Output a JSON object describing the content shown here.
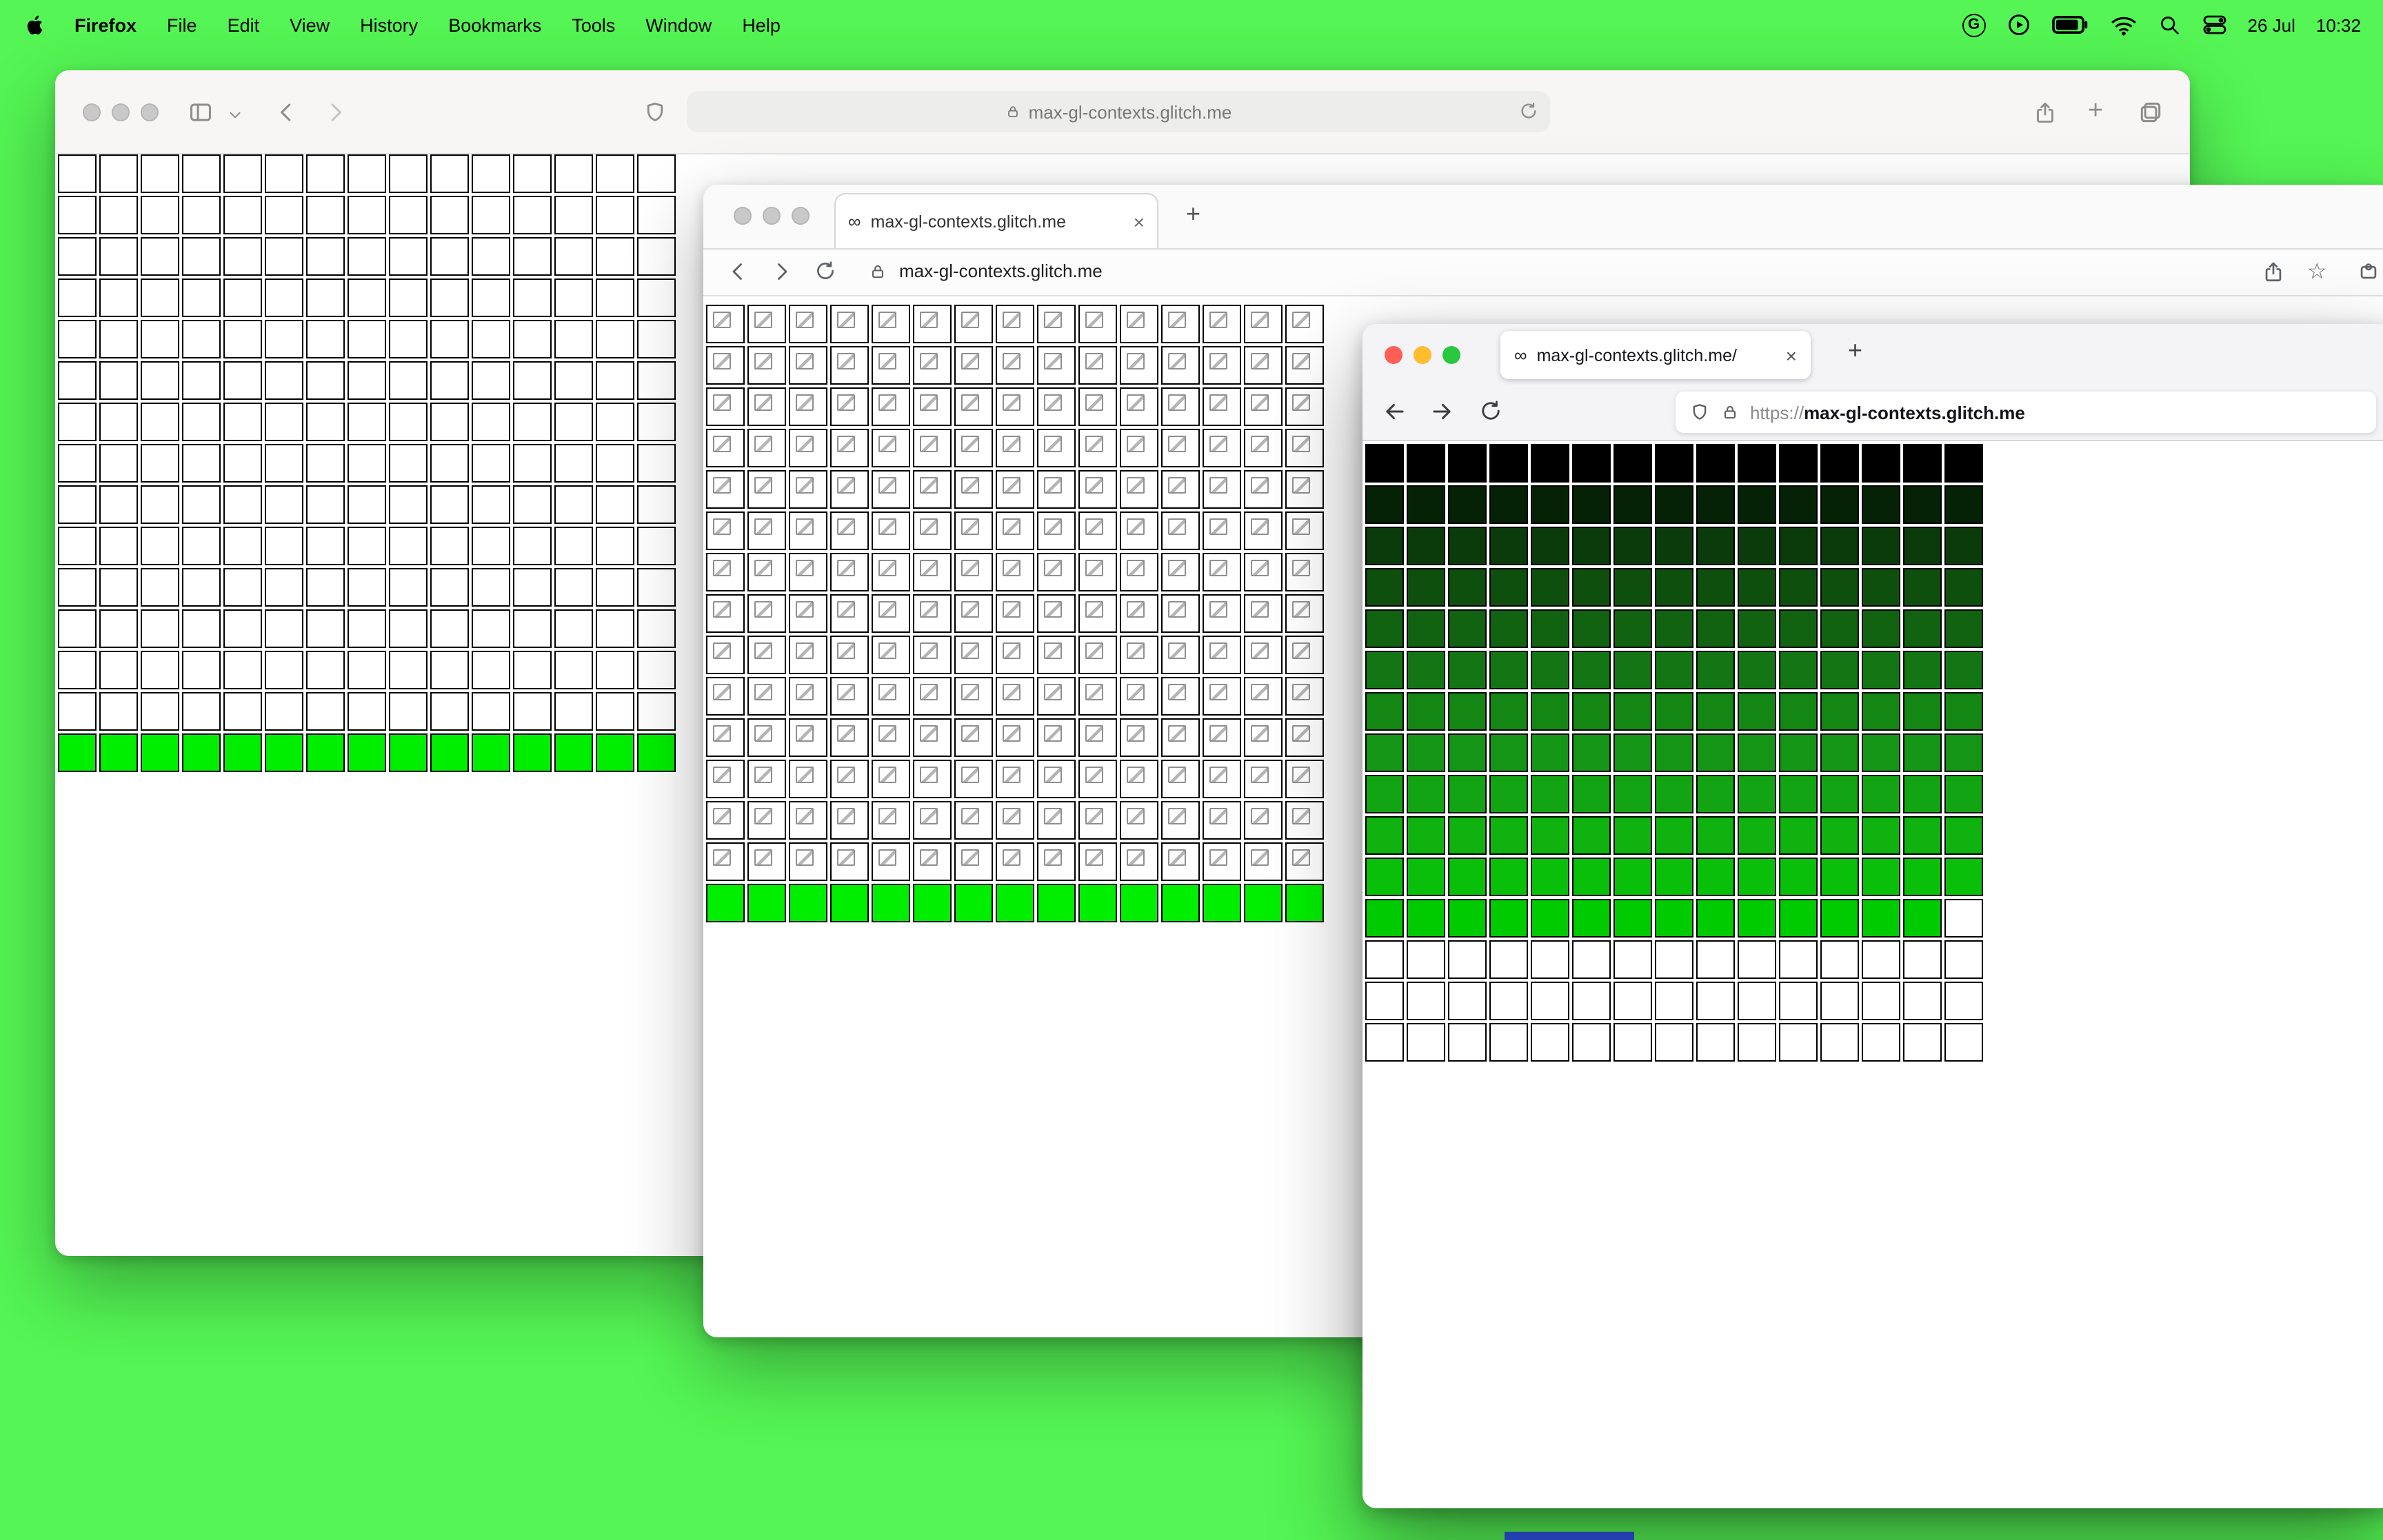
{
  "desktop": {
    "background": "#54f554",
    "bright_green": "#00ee00"
  },
  "menu_bar": {
    "app_name": "Firefox",
    "menus": [
      "File",
      "Edit",
      "View",
      "History",
      "Bookmarks",
      "Tools",
      "Window",
      "Help"
    ],
    "date": "26 Jul",
    "time": "10:32"
  },
  "icons": {
    "infinity": "∞",
    "close": "×",
    "plus": "+",
    "star": "☆",
    "google_letter": "G",
    "chevron_down": "⌄"
  },
  "window_back": {
    "url": "max-gl-contexts.glitch.me",
    "grid": {
      "cols": 15,
      "rows": 15,
      "row_colors": [
        "#ffffff",
        "#ffffff",
        "#ffffff",
        "#ffffff",
        "#ffffff",
        "#ffffff",
        "#ffffff",
        "#ffffff",
        "#ffffff",
        "#ffffff",
        "#ffffff",
        "#ffffff",
        "#ffffff",
        "#ffffff",
        "#00ee00"
      ]
    }
  },
  "window_middle": {
    "tab_title": "max-gl-contexts.glitch.me",
    "url": "max-gl-contexts.glitch.me",
    "grid": {
      "cols": 15,
      "rows": 15,
      "row_colors": [
        "#ffffff",
        "#ffffff",
        "#ffffff",
        "#ffffff",
        "#ffffff",
        "#ffffff",
        "#ffffff",
        "#ffffff",
        "#ffffff",
        "#ffffff",
        "#ffffff",
        "#ffffff",
        "#ffffff",
        "#ffffff",
        "#00ee00"
      ],
      "broken_rows": [
        0,
        1,
        2,
        3,
        4,
        5,
        6,
        7,
        8,
        9,
        10,
        11,
        12,
        13
      ]
    }
  },
  "window_front": {
    "tab_title": "max-gl-contexts.glitch.me/",
    "url_scheme": "https://",
    "url_host": "max-gl-contexts.glitch.me",
    "grid": {
      "cols": 15,
      "rows": 15,
      "row_colors": [
        "#000000",
        "#062206",
        "#0b3a0b",
        "#0e4f0e",
        "#116311",
        "#137513",
        "#148614",
        "#159515",
        "#13a413",
        "#10b210",
        "#0abf0a",
        "#00cb00",
        "#ffffff",
        "#ffffff",
        "#ffffff"
      ],
      "overrides": [
        {
          "row": 11,
          "col": 14,
          "color": "#ffffff"
        }
      ]
    }
  }
}
